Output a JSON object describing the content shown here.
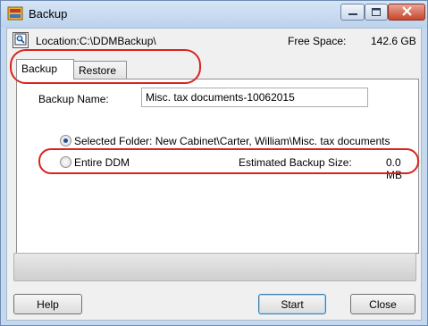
{
  "window": {
    "title": "Backup"
  },
  "location": {
    "label": "Location:C:\\DDMBackup\\"
  },
  "free_space": {
    "label": "Free Space:",
    "value": "142.6 GB"
  },
  "tabs": [
    {
      "label": "Backup"
    },
    {
      "label": "Restore"
    }
  ],
  "backup_name": {
    "label": "Backup Name:",
    "value": "Misc. tax documents-10062015"
  },
  "options": {
    "selected_folder": {
      "label": "Selected Folder:  New Cabinet\\Carter, William\\Misc. tax documents",
      "checked": true
    },
    "entire_ddm": {
      "label": "Entire DDM",
      "checked": false
    }
  },
  "estimated_size": {
    "label": "Estimated Backup Size:",
    "value": "0.0 MB"
  },
  "progress": {
    "fraction": 0
  },
  "buttons": {
    "help": "Help",
    "start": "Start",
    "close": "Close"
  },
  "colors": {
    "highlight": "#d9231f",
    "title_bar": "#c4d8ee",
    "close_button": "#c8452a"
  },
  "icons": {
    "app": "backup-app-icon",
    "location": "location-browse-icon"
  }
}
